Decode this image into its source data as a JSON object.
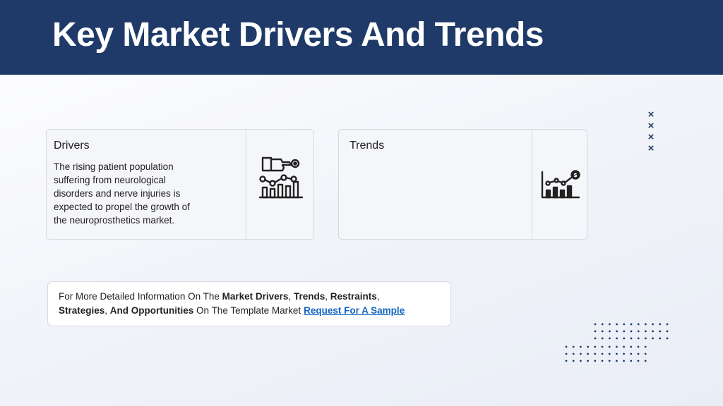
{
  "page": {
    "title": "Key Market Drivers And Trends"
  },
  "drivers_card": {
    "heading": "Drivers",
    "body": "The rising patient population suffering from neurological disorders and nerve injuries is expected to propel the growth of the neuroprosthetics market.",
    "icon": "hand-graph-icon"
  },
  "trends_card": {
    "heading": "Trends",
    "body": "",
    "icon": "growth-chart-dollar-icon"
  },
  "decor": {
    "x_marks": [
      "×",
      "×",
      "×",
      "×"
    ]
  },
  "info_box": {
    "text_1": "For More Detailed Information On The ",
    "bold_1": "Market Drivers",
    "sep_1": ", ",
    "bold_2": "Trends",
    "sep_2": ", ",
    "bold_3": "Restraints",
    "sep_3": ",",
    "bold_4": "Strategies",
    "sep_4": ", ",
    "bold_5": "And Opportunities",
    "text_2": " On The Template Market",
    "link_label": "Request For A Sample"
  },
  "colors": {
    "header_bg": "#1f3a68",
    "accent": "#1f3a68",
    "link": "#1565c0"
  }
}
